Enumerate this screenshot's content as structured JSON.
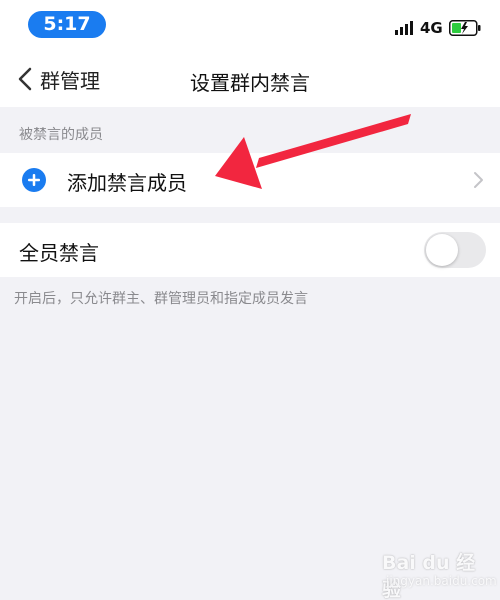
{
  "status_bar": {
    "time": "5:17",
    "network": "4G",
    "time_pill_color": "#1a7cf0",
    "battery_color": "#2ecc40"
  },
  "nav": {
    "back_label": "群管理",
    "title": "设置群内禁言"
  },
  "muted_members": {
    "section_header": "被禁言的成员",
    "add_label": "添加禁言成员",
    "plus_icon_color": "#1a7cf0"
  },
  "mute_all": {
    "label": "全员禁言",
    "enabled": false,
    "helper": "开启后，只允许群主、群管理员和指定成员发言"
  },
  "annotation": {
    "arrow_color": "#f2263f"
  },
  "watermark": {
    "brand": "Bai du 经验",
    "sub": "jingyan.baidu.com"
  }
}
